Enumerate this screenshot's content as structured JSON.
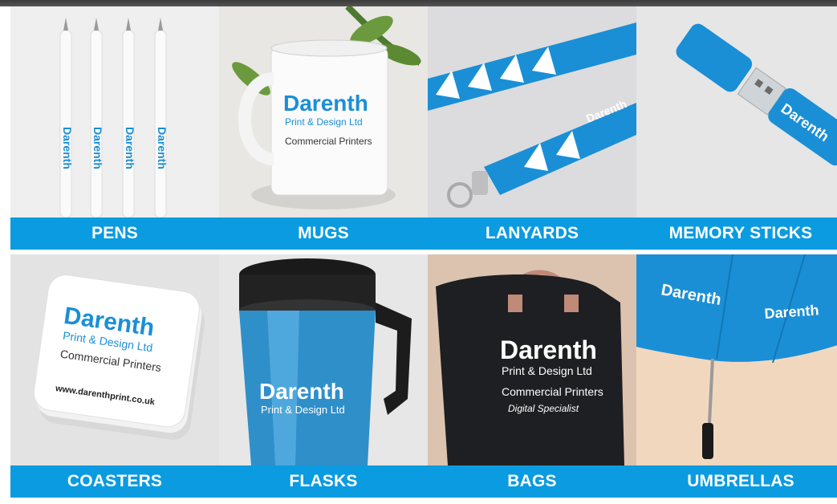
{
  "products": [
    {
      "id": "pens",
      "label": "PENS"
    },
    {
      "id": "mugs",
      "label": "MUGS"
    },
    {
      "id": "lanyards",
      "label": "LANYARDS"
    },
    {
      "id": "memory-sticks",
      "label": "MEMORY STICKS"
    },
    {
      "id": "coasters",
      "label": "COASTERS"
    },
    {
      "id": "flasks",
      "label": "FLASKS"
    },
    {
      "id": "bags",
      "label": "BAGS"
    },
    {
      "id": "umbrellas",
      "label": "UMBRELLAS"
    }
  ],
  "branding": {
    "name": "Darenth",
    "subtitle": "Print & Design Ltd",
    "tagline": "Commercial Printers",
    "script_line": "Digital Specialist",
    "website": "www.darenthprint.co.uk"
  },
  "colors": {
    "label_bg": "#0a9be0",
    "brand_blue": "#1a8fd6",
    "label_text": "#ffffff"
  }
}
